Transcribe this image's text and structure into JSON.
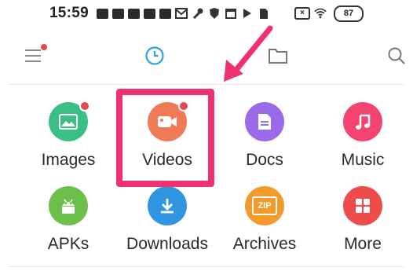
{
  "status_bar": {
    "time": "15:59",
    "battery": "87"
  },
  "app_bar": {
    "menu_icon": "hamburger-menu-icon",
    "recent_icon": "clock-icon",
    "folder_icon": "folder-icon",
    "search_icon": "search-icon",
    "accent_color": "#2aa3dc"
  },
  "categories": [
    {
      "label": "Images",
      "icon": "image-icon",
      "color": "#3cbf86",
      "badge": true
    },
    {
      "label": "Videos",
      "icon": "video-camera-icon",
      "color": "#f07a55",
      "badge": true
    },
    {
      "label": "Docs",
      "icon": "document-icon",
      "color": "#9b6ae8",
      "badge": false
    },
    {
      "label": "Music",
      "icon": "music-note-icon",
      "color": "#f2446f",
      "badge": false
    },
    {
      "label": "APKs",
      "icon": "android-icon",
      "color": "#6cc04a",
      "badge": false
    },
    {
      "label": "Downloads",
      "icon": "download-icon",
      "color": "#2f95e0",
      "badge": false
    },
    {
      "label": "Archives",
      "icon": "zip-icon",
      "color": "#f39a2b",
      "badge": false,
      "icon_text": "ZIP"
    },
    {
      "label": "More",
      "icon": "grid-more-icon",
      "color": "#ef4b4b",
      "badge": false
    }
  ],
  "highlight": {
    "target": "Videos",
    "color": "#f0306f"
  }
}
